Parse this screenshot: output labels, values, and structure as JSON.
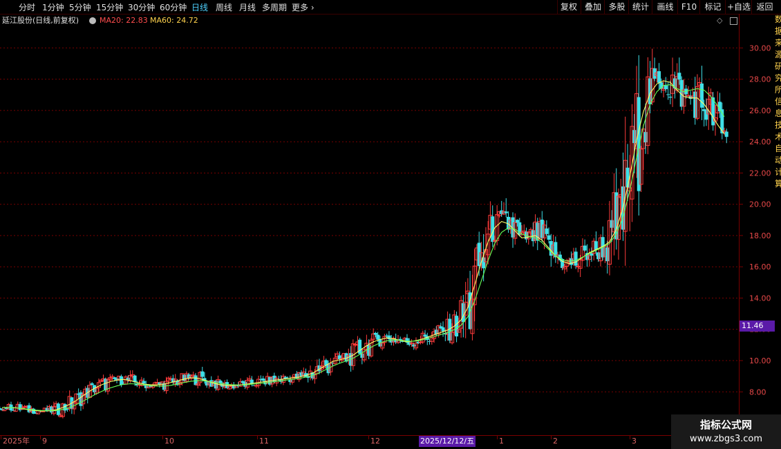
{
  "toolbar": {
    "periods": [
      "分时",
      "1分钟",
      "5分钟",
      "15分钟",
      "30分钟",
      "60分钟",
      "日线",
      "周线",
      "月线",
      "多周期",
      "更多"
    ],
    "active_period": "日线",
    "actions": [
      "复权",
      "叠加",
      "多股",
      "统计",
      "画线",
      "F10",
      "标记",
      "+自选",
      "返回"
    ]
  },
  "legend": {
    "stock_name": "延江股份(日线,前复权)",
    "ma20_label": "MA20: 22.83",
    "ma60_label": "MA60: 24.72"
  },
  "last_price": "11.46",
  "date_labels": [
    "2025年",
    "9",
    "10",
    "11",
    "12",
    "2025/12/12/五",
    "1",
    "2",
    "3"
  ],
  "side_strip_text": "数据来源研究所信息技术自动计算",
  "watermark": {
    "title": "指标公式网",
    "url": "www.zbgs3.com"
  },
  "colors": {
    "up": "#ff3b3b",
    "down": "#3fe0e8",
    "ma20": "#ffff66",
    "ma60": "#66ff55",
    "grid": "#7a0000",
    "axis_text": "#e84848",
    "highlight": "#5a1aa8"
  },
  "chart_data": {
    "type": "candlestick",
    "y_ticks": [
      "30.00",
      "28.00",
      "26.00",
      "24.00",
      "22.00",
      "20.00",
      "18.00",
      "16.00",
      "14.00",
      "12.00",
      "10.00",
      "8.00"
    ],
    "ylim": [
      6.2,
      31.3
    ],
    "x_axis_labels": [
      "2025年",
      "9",
      "10",
      "11",
      "12",
      "1",
      "2",
      "3"
    ],
    "series": [
      {
        "name": "MA20",
        "values": [
          7.0,
          7.0,
          6.98,
          6.92,
          6.85,
          6.8,
          6.78,
          6.8,
          6.85,
          7.0,
          7.2,
          7.45,
          7.75,
          8.05,
          8.3,
          8.5,
          8.65,
          8.75,
          8.8,
          8.72,
          8.6,
          8.5,
          8.45,
          8.45,
          8.5,
          8.6,
          8.7,
          8.82,
          8.9,
          8.88,
          8.75,
          8.6,
          8.48,
          8.42,
          8.4,
          8.43,
          8.48,
          8.54,
          8.6,
          8.66,
          8.72,
          8.78,
          8.84,
          8.9,
          8.95,
          9.05,
          9.2,
          9.45,
          9.7,
          9.95,
          10.05,
          10.15,
          10.35,
          10.65,
          10.95,
          11.2,
          11.35,
          11.45,
          11.4,
          11.28,
          11.2,
          11.25,
          11.35,
          11.5,
          11.65,
          11.8,
          11.95,
          12.2,
          12.6,
          13.4,
          14.8,
          16.3,
          17.6,
          18.5,
          18.9,
          18.75,
          18.3,
          17.85,
          17.9,
          18.0,
          17.7,
          17.2,
          16.7,
          16.35,
          16.2,
          16.3,
          16.6,
          16.9,
          17.1,
          17.3,
          17.6,
          18.4,
          19.8,
          21.8,
          24.1,
          25.9,
          27.1,
          27.7,
          27.9,
          27.8,
          27.3,
          26.9,
          26.8,
          26.8,
          26.4,
          25.8,
          25.1,
          24.5
        ]
      },
      {
        "name": "MA60",
        "values": [
          7.0,
          7.0,
          6.98,
          6.94,
          6.88,
          6.83,
          6.8,
          6.79,
          6.8,
          6.88,
          7.0,
          7.18,
          7.4,
          7.65,
          7.88,
          8.08,
          8.25,
          8.38,
          8.48,
          8.52,
          8.5,
          8.45,
          8.4,
          8.37,
          8.37,
          8.42,
          8.5,
          8.6,
          8.68,
          8.72,
          8.7,
          8.63,
          8.56,
          8.5,
          8.46,
          8.44,
          8.45,
          8.49,
          8.53,
          8.58,
          8.63,
          8.69,
          8.75,
          8.8,
          8.86,
          8.94,
          9.05,
          9.22,
          9.43,
          9.65,
          9.83,
          9.98,
          10.15,
          10.4,
          10.68,
          10.93,
          11.13,
          11.27,
          11.33,
          11.3,
          11.24,
          11.24,
          11.3,
          11.41,
          11.53,
          11.66,
          11.8,
          11.98,
          12.26,
          12.8,
          13.8,
          15.1,
          16.4,
          17.5,
          18.2,
          18.5,
          18.4,
          18.1,
          17.95,
          17.85,
          17.55,
          17.1,
          16.7,
          16.45,
          16.35,
          16.42,
          16.62,
          16.85,
          17.05,
          17.25,
          17.5,
          18.1,
          19.2,
          20.9,
          23.0,
          25.0,
          26.4,
          27.2,
          27.6,
          27.65,
          27.4,
          27.2,
          27.3,
          27.4,
          27.3,
          26.9,
          26.3,
          25.6
        ]
      }
    ]
  }
}
